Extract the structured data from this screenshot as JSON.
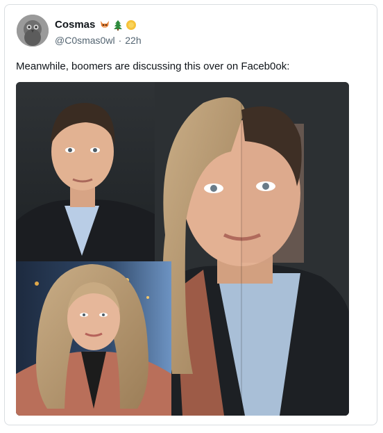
{
  "post": {
    "display_name": "Cosmas",
    "handle": "@C0smas0wl",
    "separator": "·",
    "time": "22h",
    "badges": [
      "fox-emoji-icon",
      "tree-emoji-icon",
      "sun-emoji-icon"
    ],
    "text": "Meanwhile, boomers are discussing this over on Faceb0ok:"
  }
}
